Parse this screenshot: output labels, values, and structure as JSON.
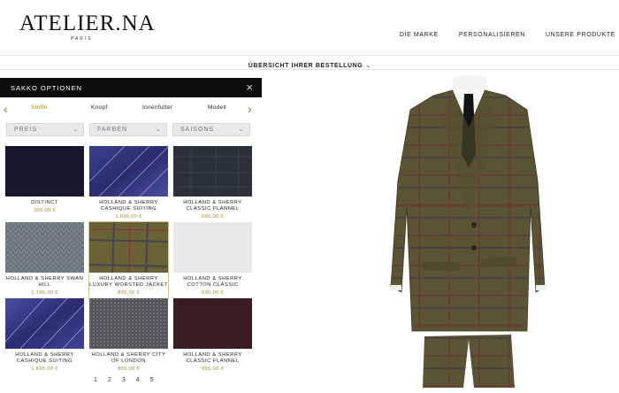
{
  "brand": {
    "name": "ATELIER.NA",
    "sub": "PARIS"
  },
  "nav": [
    "DIE MARKE",
    "PERSONALISIEREN",
    "UNSERE PRODUKTE"
  ],
  "order_bar": {
    "label": "ÜBERSICHT IHRER BESTELLUNG",
    "icon": "chevron-down-icon"
  },
  "panel": {
    "title": "SAKKO OPTIONEN",
    "close_icon": "close-icon",
    "tabs": [
      {
        "label": "Stoffe",
        "active": true
      },
      {
        "label": "Knopf",
        "active": false
      },
      {
        "label": "Innenfutter",
        "active": false
      },
      {
        "label": "Modell",
        "active": false
      }
    ],
    "filters": [
      "PREIS",
      "FARBEN",
      "SAISONS"
    ],
    "fabrics": [
      {
        "name": "DISTINCT",
        "price": "395,00 €",
        "swatch": "navy-plain"
      },
      {
        "name": "HOLLAND & SHERRY CASHIQUE SUITING",
        "price": "1.695,00 €",
        "swatch": "blue-pinstripe"
      },
      {
        "name": "HOLLAND & SHERRY CLASSIC FLANNEL",
        "price": "995,00 €",
        "swatch": "charcoal-check"
      },
      {
        "name": "HOLLAND & SHERRY SWAN HILL",
        "price": "1.195,00 €",
        "swatch": "grey-herringbone"
      },
      {
        "name": "HOLLAND & SHERRY LUXURY WORSTED JACKET",
        "price": "895,00 €",
        "swatch": "olive-windowpane",
        "selected": true
      },
      {
        "name": "HOLLAND & SHERRY COTTON CLASSIC",
        "price": "595,00 €",
        "swatch": "light-grey"
      },
      {
        "name": "HOLLAND & SHERRY CASHIQUE SUITING",
        "price": "1.695,00 €",
        "swatch": "blue-pinstripe"
      },
      {
        "name": "HOLLAND & SHERRY CITY OF LONDON",
        "price": "865,00 €",
        "swatch": "grey-tweed"
      },
      {
        "name": "HOLLAND & SHERRY CLASSIC FLANNEL",
        "price": "995,00 €",
        "swatch": "burgundy"
      }
    ],
    "pages": [
      "1",
      "2",
      "3",
      "4",
      "5"
    ]
  },
  "colors": {
    "accent": "#a08a30",
    "panel_header": "#0d0d0d",
    "suit": "#5a5233",
    "suit_check": "#7a2f3a"
  }
}
